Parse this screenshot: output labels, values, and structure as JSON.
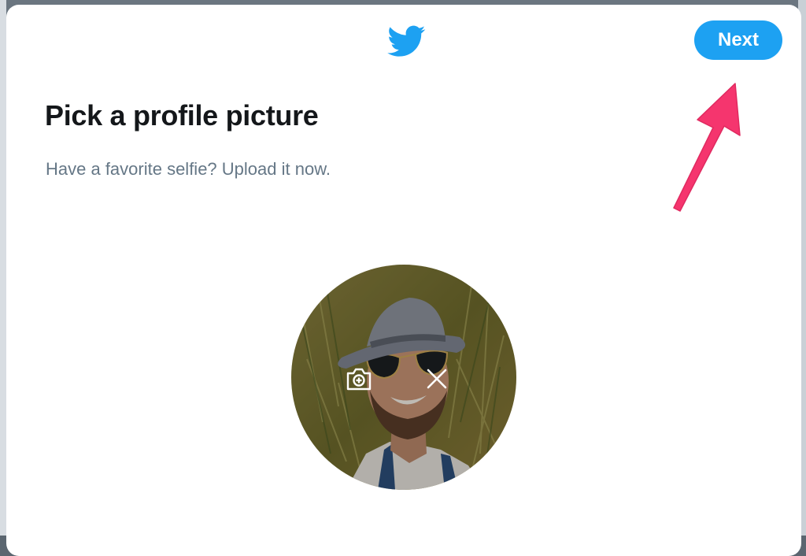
{
  "header": {
    "logo_icon": "twitter-bird-icon",
    "next_label": "Next"
  },
  "content": {
    "title": "Pick a profile picture",
    "subtitle": "Have a favorite selfie? Upload it now."
  },
  "avatar": {
    "actions": [
      {
        "icon": "camera-plus-icon"
      },
      {
        "icon": "close-icon"
      }
    ]
  },
  "colors": {
    "brand_blue": "#1da1f2",
    "title_text": "#14171a",
    "subtitle_text": "#657786",
    "annotation_arrow": "#f5356e"
  }
}
